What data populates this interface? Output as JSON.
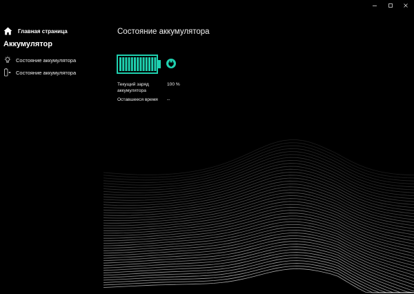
{
  "window": {
    "controls": [
      "minimize",
      "maximize",
      "close"
    ]
  },
  "sidebar": {
    "home_label": "Главная страница",
    "section_title": "Аккумулятор",
    "items": [
      {
        "label": "Состояние аккумулятора",
        "icon": "lightbulb-icon"
      },
      {
        "label": "Состояние аккумулятора",
        "icon": "battery-plug-icon"
      }
    ]
  },
  "main": {
    "title": "Состояние аккумулятора",
    "battery": {
      "level": 1.0,
      "charging": true,
      "color": "#1fd1b0"
    },
    "info": [
      {
        "label": "Текущий заряд аккумулятора",
        "value": "100 %"
      },
      {
        "label": "Оставшееся время",
        "value": "--"
      }
    ]
  },
  "colors": {
    "background": "#000000",
    "accent": "#1fd1b0",
    "text": "#ffffff"
  }
}
